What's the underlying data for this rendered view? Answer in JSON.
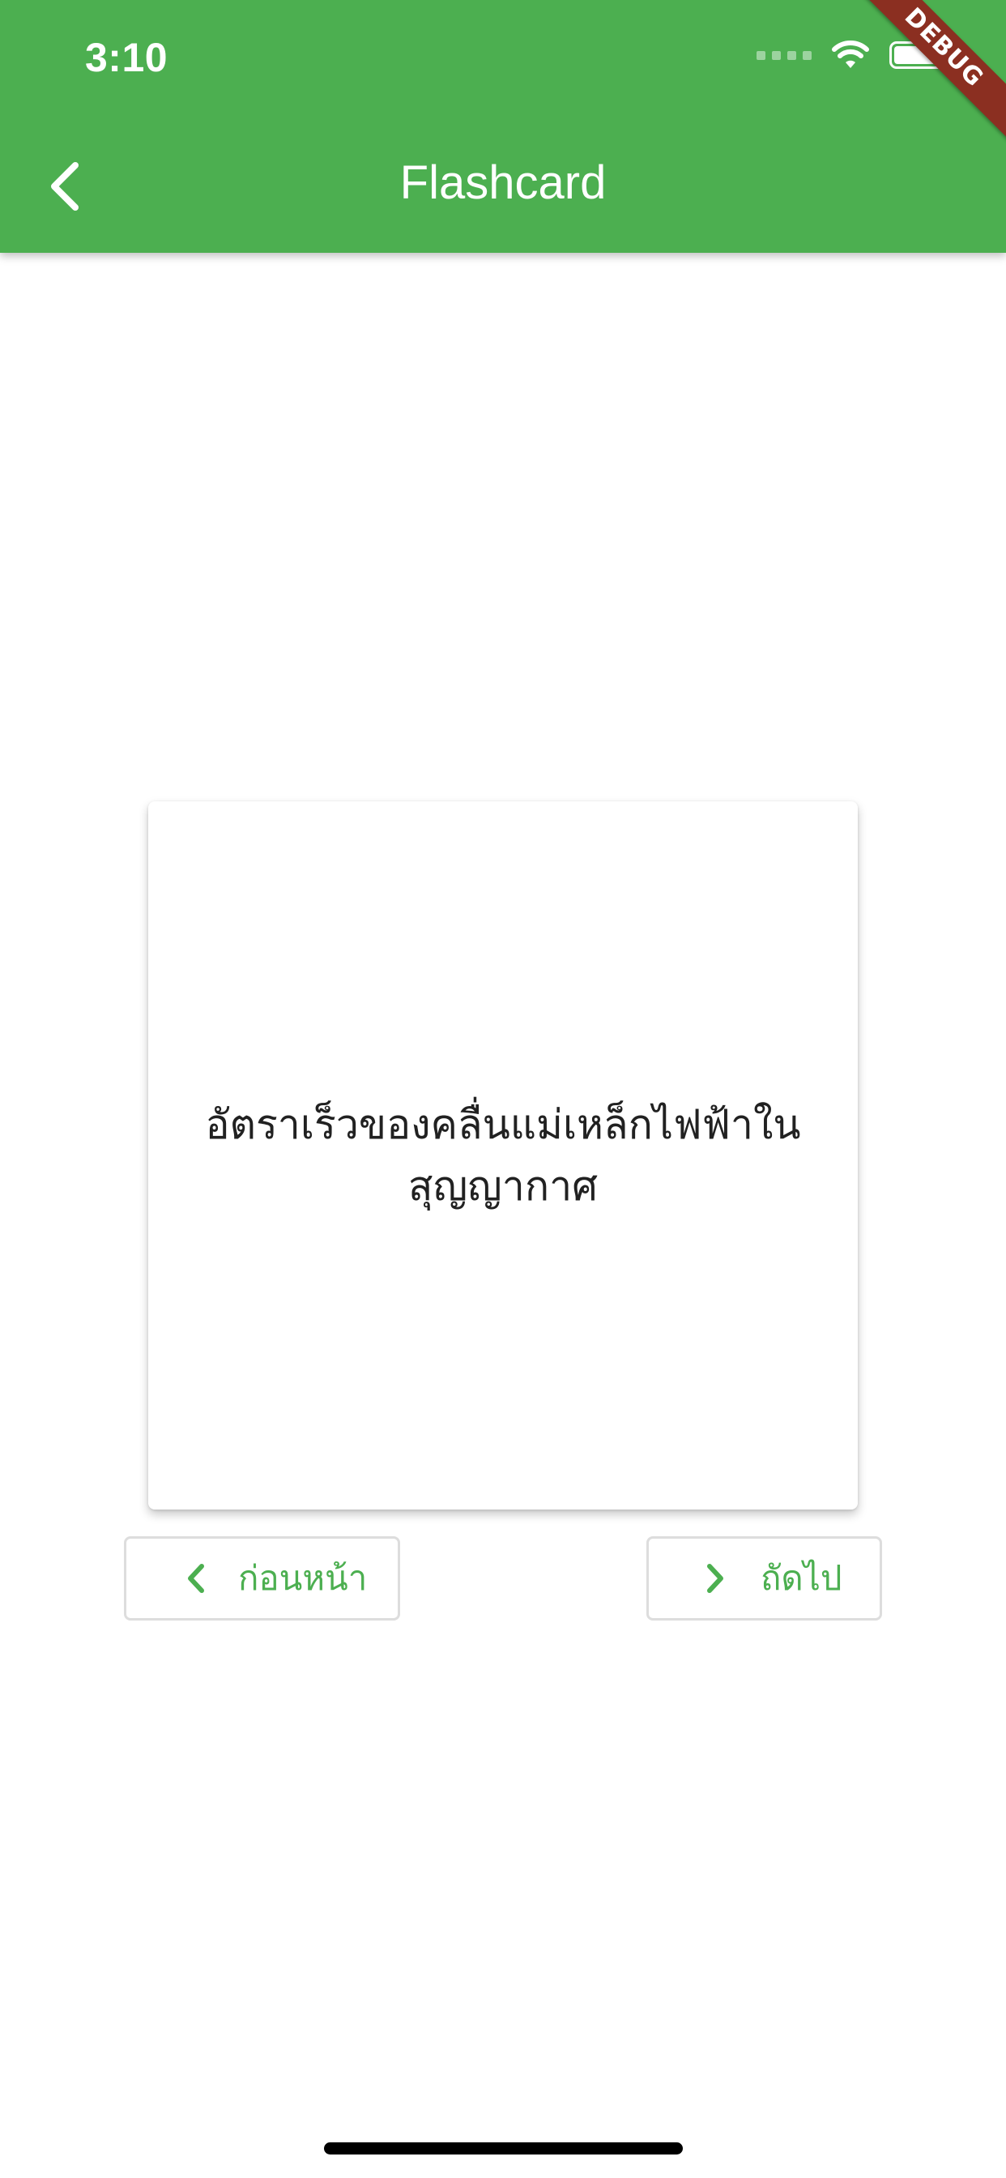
{
  "status_bar": {
    "time": "3:10",
    "icons": [
      "signal-icon",
      "wifi-icon",
      "battery-icon"
    ]
  },
  "app_bar": {
    "title": "Flashcard",
    "back_icon": "chevron-left-icon",
    "background_color": "#4caf50"
  },
  "debug_banner": {
    "label": "DEBUG",
    "color": "#8b2f21"
  },
  "flashcard": {
    "text": "อัตราเร็วของคลื่นแม่เหล็กไฟฟ้าในสุญญากาศ"
  },
  "navigation": {
    "previous_label": "ก่อนหน้า",
    "previous_icon": "chevron-left-icon",
    "next_label": "ถัดไป",
    "next_icon": "chevron-right-icon",
    "accent_color": "#4caf50"
  }
}
